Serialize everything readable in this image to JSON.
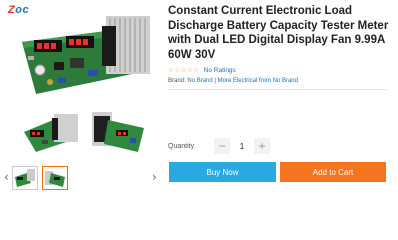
{
  "logo": {
    "part1": "Z",
    "part2": "oc"
  },
  "product": {
    "title": "Constant Current Electronic Load Discharge Battery Capacity Tester Meter with Dual LED Digital Display Fan 9.99A 60W 30V",
    "stars": "☆☆☆☆☆",
    "ratings_label": "No Ratings",
    "brand_prefix": "Brand:",
    "brand_name": "No Brand",
    "brand_more": "More Electrical from No Brand",
    "brand_sep": "|"
  },
  "quantity": {
    "label": "Quantity",
    "value": "1",
    "minus": "−",
    "plus": "+"
  },
  "actions": {
    "buy_now": "Buy Now",
    "add_to_cart": "Add to Cart"
  },
  "gallery": {
    "prev": "‹",
    "next": "›"
  },
  "colors": {
    "buy": "#29a9e0",
    "cart": "#f57420",
    "link": "#1e73be",
    "star": "#f5a623"
  }
}
